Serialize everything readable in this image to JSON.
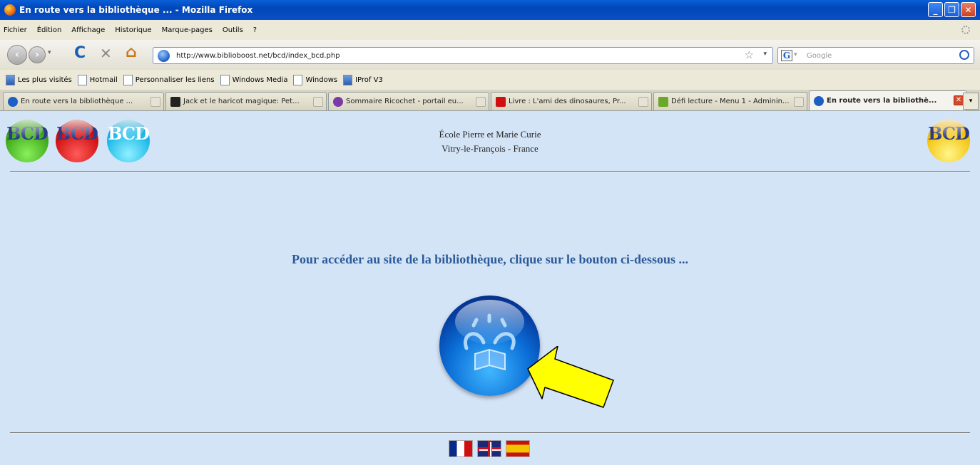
{
  "window": {
    "title": "En route vers la bibliothèque ... - Mozilla Firefox",
    "min_label": "_",
    "max_label": "❐",
    "close_label": "✕"
  },
  "menu": [
    "Fichier",
    "Édition",
    "Affichage",
    "Historique",
    "Marque-pages",
    "Outils",
    "?"
  ],
  "nav": {
    "url": "http://www.biblioboost.net/bcd/index_bcd.php",
    "search_placeholder": "Google",
    "back_glyph": "‹",
    "forward_glyph": "›",
    "reload_glyph": "C",
    "stop_glyph": "✕",
    "home_glyph": "⌂",
    "star_glyph": "☆",
    "drop_glyph": "▾",
    "search_engine_glyph": "G"
  },
  "bookmarks": [
    {
      "label": "Les plus visités",
      "icon": "blue"
    },
    {
      "label": "Hotmail",
      "icon": "page"
    },
    {
      "label": "Personnaliser les liens",
      "icon": "page"
    },
    {
      "label": "Windows Media",
      "icon": "page"
    },
    {
      "label": "Windows",
      "icon": "page"
    },
    {
      "label": "IProf V3",
      "icon": "blue"
    }
  ],
  "tabs": [
    {
      "label": "En route vers la bibliothèque ...",
      "icon_color": "#1d5fc4",
      "active": false
    },
    {
      "label": "Jack et le haricot magique: Pet...",
      "icon_color": "#222222",
      "active": false
    },
    {
      "label": "Sommaire Ricochet - portail eu...",
      "icon_color": "#7a3aa8",
      "active": false
    },
    {
      "label": "Livre : L'ami des dinosaures, Pr...",
      "icon_color": "#d01010",
      "active": false
    },
    {
      "label": "Défi lecture - Menu 1 - Adminin...",
      "icon_color": "#6aa82a",
      "active": false
    },
    {
      "label": "En route vers la bibliothè...",
      "icon_color": "#1d5fc4",
      "active": true
    }
  ],
  "tab_more_glyph": "▾",
  "page": {
    "logo_text": "BCD",
    "school_line1": "École Pierre et Marie Curie",
    "school_line2": "Vitry-le-François - France",
    "headline": "Pour accéder au site de la bibliothèque, clique sur le bouton ci-dessous ...",
    "arrow_color": "#ffff00"
  }
}
